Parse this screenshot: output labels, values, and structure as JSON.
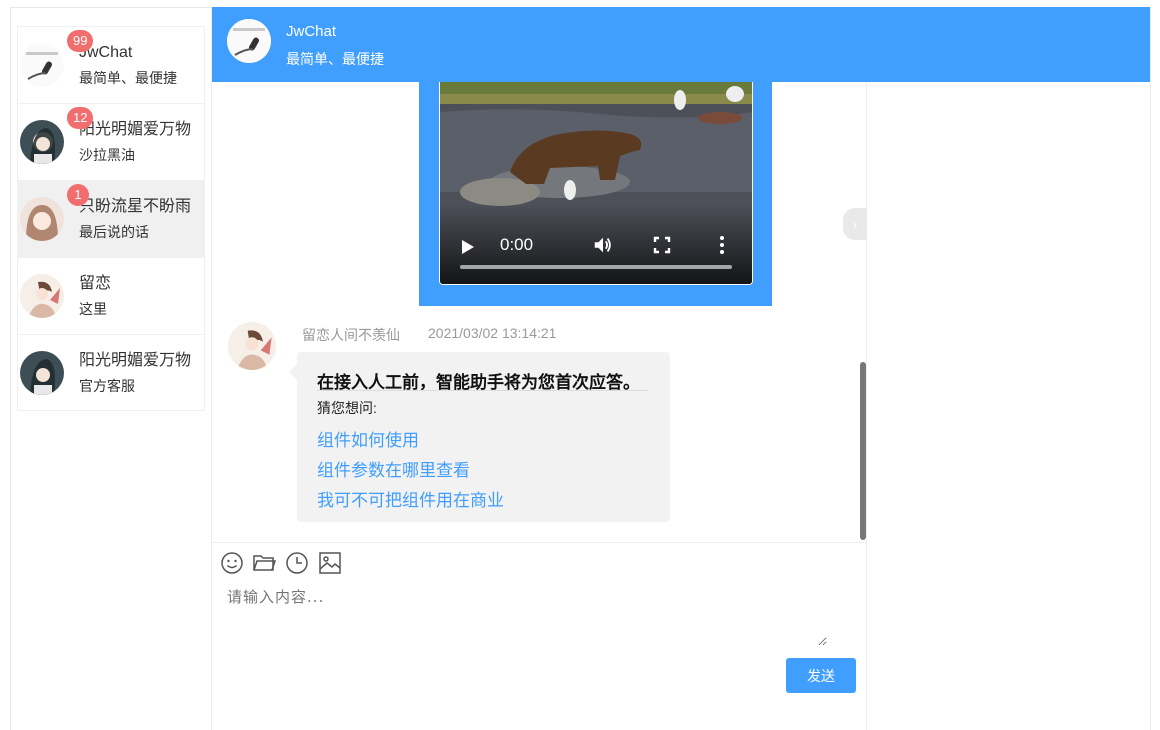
{
  "contacts": [
    {
      "name": "JwChat",
      "sub": "最简单、最便捷",
      "badge": "99"
    },
    {
      "name": "阳光明媚爱万物",
      "sub": "沙拉黑油",
      "badge": "12"
    },
    {
      "name": "只盼流星不盼雨",
      "sub": "最后说的话",
      "badge": "1"
    },
    {
      "name": "留恋",
      "sub": "这里",
      "badge": ""
    },
    {
      "name": "阳光明媚爱万物",
      "sub": "官方客服",
      "badge": ""
    }
  ],
  "header": {
    "title": "JwChat",
    "subtitle": "最简单、最便捷"
  },
  "video": {
    "time": "0:00"
  },
  "message": {
    "sender": "留恋人间不羡仙",
    "time": "2021/03/02 13:14:21",
    "title": "在接入人工前，智能助手将为您首次应答。",
    "guess_label": "猜您想问:",
    "links": [
      "组件如何使用",
      "组件参数在哪里查看",
      "我可不可把组件用在商业"
    ]
  },
  "input": {
    "placeholder": "请输入内容..."
  },
  "send_label": "发送",
  "icons": [
    "emoji-icon",
    "folder-icon",
    "history-icon",
    "image-icon"
  ],
  "colors": {
    "primary": "#409eff",
    "badge": "#f26d6d"
  }
}
